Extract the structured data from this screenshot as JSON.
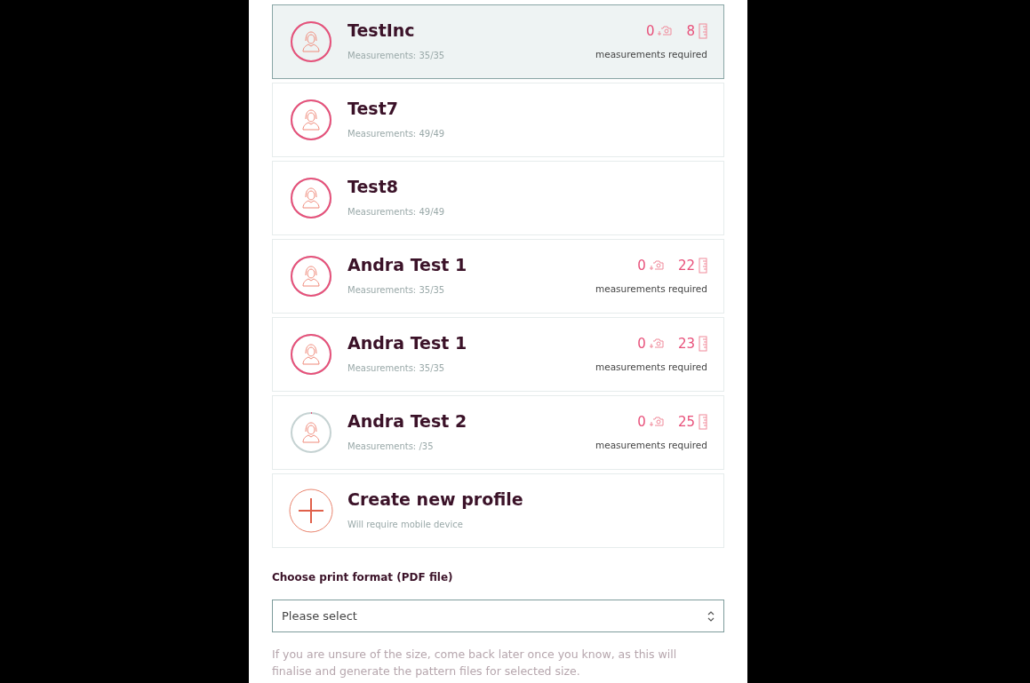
{
  "profiles": [
    {
      "name": "TestInc",
      "measurements": "Measurements: 35/35",
      "level": 1,
      "selected": true,
      "photos": "0",
      "required": "8",
      "required_label": "measurements required"
    },
    {
      "name": "Test7",
      "measurements": "Measurements: 49/49",
      "level": 1,
      "selected": false
    },
    {
      "name": "Test8",
      "measurements": "Measurements: 49/49",
      "level": 1,
      "selected": false
    },
    {
      "name": "Andra Test 1",
      "measurements": "Measurements: 35/35",
      "level": 1,
      "selected": false,
      "photos": "0",
      "required": "22",
      "required_label": "measurements required"
    },
    {
      "name": "Andra Test 1",
      "measurements": "Measurements: 35/35",
      "level": 1,
      "selected": false,
      "photos": "0",
      "required": "23",
      "required_label": "measurements required"
    },
    {
      "name": "Andra Test 2",
      "measurements": "Measurements: /35",
      "level": 0,
      "selected": false,
      "photos": "0",
      "required": "25",
      "required_label": "measurements required"
    }
  ],
  "create": {
    "title": "Create new profile",
    "subtitle": "Will require mobile device"
  },
  "print_format": {
    "label": "Choose print format (PDF file)",
    "placeholder": "Please select",
    "hint": "If you are unsure of the size, come back later once you know, as this will finalise and generate the pattern files for selected size."
  }
}
